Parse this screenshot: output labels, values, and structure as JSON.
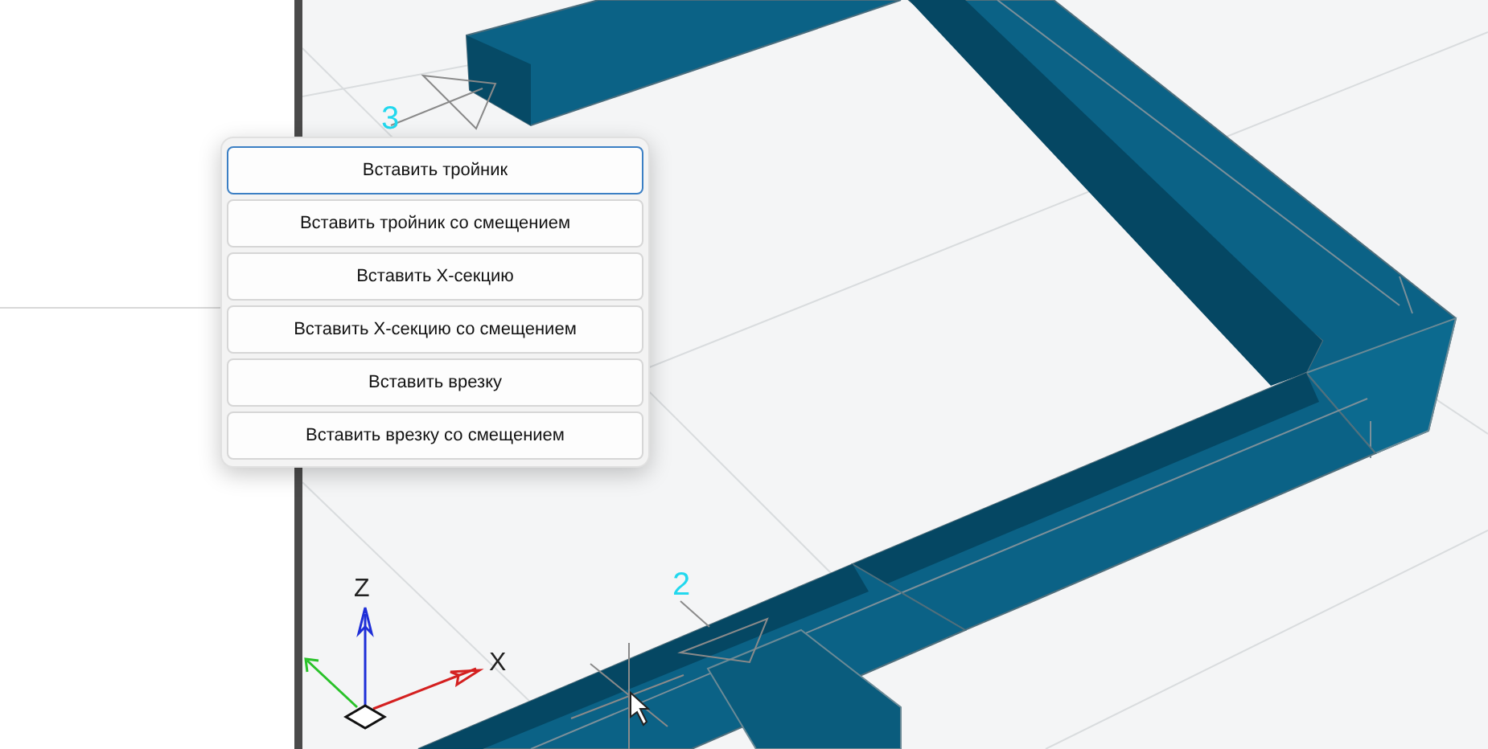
{
  "viewport": {
    "markers": [
      {
        "label": "3"
      },
      {
        "label": "2"
      }
    ],
    "axes": {
      "z": "Z",
      "x": "X"
    }
  },
  "context_menu": {
    "items": [
      {
        "label": "Вставить тройник",
        "selected": true
      },
      {
        "label": "Вставить тройник со смещением",
        "selected": false
      },
      {
        "label": "Вставить X-секцию",
        "selected": false
      },
      {
        "label": "Вставить X-секцию со смещением",
        "selected": false
      },
      {
        "label": "Вставить врезку",
        "selected": false
      },
      {
        "label": "Вставить врезку со смещением",
        "selected": false
      }
    ]
  }
}
